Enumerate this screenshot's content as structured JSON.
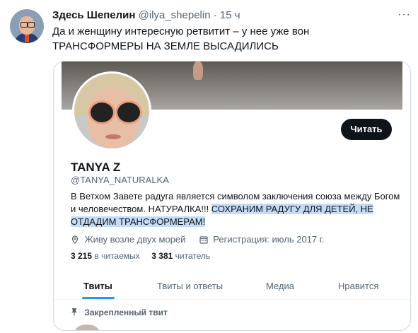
{
  "tweet": {
    "author_name": "Здесь Шепелин",
    "author_handle": "@ilya_shepelin",
    "time": "15 ч",
    "text": "Да и женщину интересную ретвитит – у нее уже вон ТРАНСФОРМЕРЫ НА ЗЕМЛЕ ВЫСАДИЛИСЬ",
    "more_label": "···"
  },
  "profile": {
    "name": "TANYA Z",
    "handle": "@TANYA_NATURALKA",
    "follow_label": "Читать",
    "bio_plain": "В Ветхом Завете радуга является символом заключения союза между Богом и человечеством. НАТУРАЛКА!!! ",
    "bio_highlight": "СОХРАНИМ РАДУГУ ДЛЯ ДЕТЕЙ, НЕ ОТДАДИМ ТРАНСФОРМЕРАМ!",
    "location": "Живу возле двух морей",
    "joined": "Регистрация: июль 2017 г.",
    "following_count": "3 215",
    "following_label": "в читаемых",
    "followers_count": "3 381",
    "followers_label": "читатель"
  },
  "tabs": [
    {
      "label": "Твиты"
    },
    {
      "label": "Твиты и ответы"
    },
    {
      "label": "Медиа"
    },
    {
      "label": "Нравится"
    }
  ],
  "pinned_label": "Закрепленный твит",
  "colors": {
    "accent": "#1d9bf0",
    "highlight": "#c4dcf7",
    "button": "#0f1419"
  },
  "icons": [
    "location-icon",
    "calendar-icon",
    "pin-icon",
    "more-icon"
  ]
}
